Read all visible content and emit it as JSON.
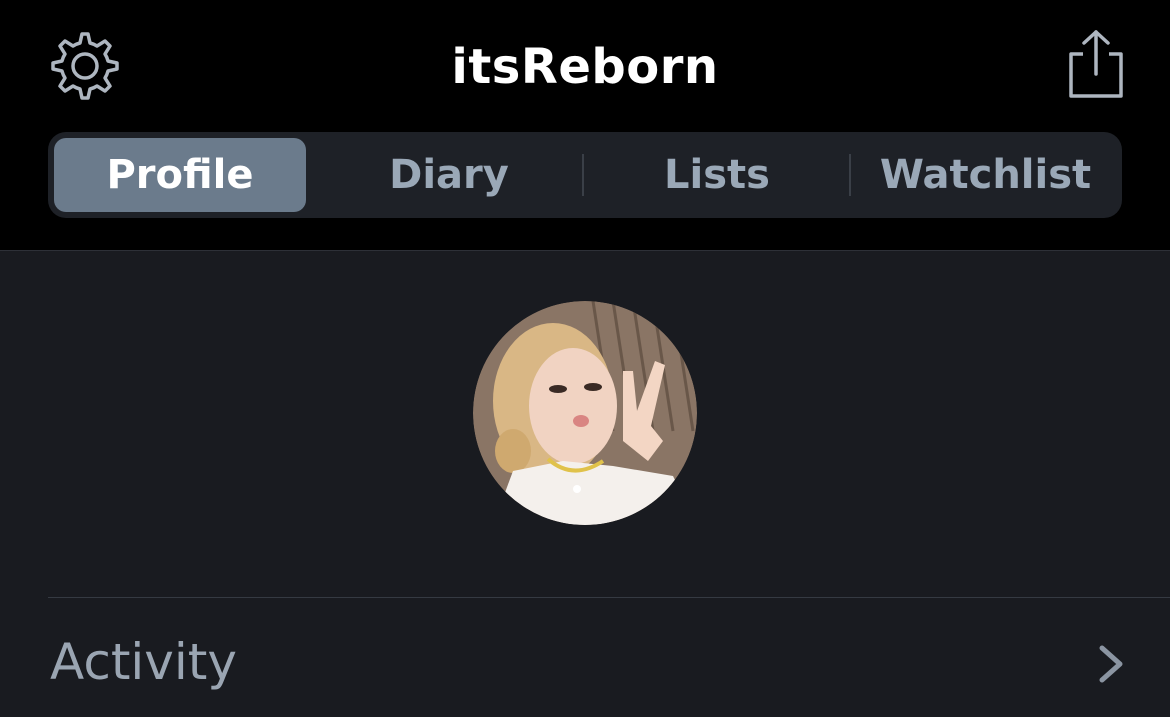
{
  "header": {
    "title": "itsReborn",
    "settings_icon": "gear-icon",
    "share_icon": "share-icon"
  },
  "tabs": [
    {
      "label": "Profile",
      "active": true
    },
    {
      "label": "Diary",
      "active": false
    },
    {
      "label": "Lists",
      "active": false
    },
    {
      "label": "Watchlist",
      "active": false
    }
  ],
  "profile": {
    "avatar_icon": "avatar"
  },
  "activity": {
    "label": "Activity",
    "icon": "chevron-right-icon"
  },
  "colors": {
    "header_bg": "#000000",
    "content_bg": "#191b20",
    "tab_active_bg": "#6b7b8c",
    "tab_inactive_text": "#9aa8b7",
    "activity_text": "#9aa5b2"
  }
}
